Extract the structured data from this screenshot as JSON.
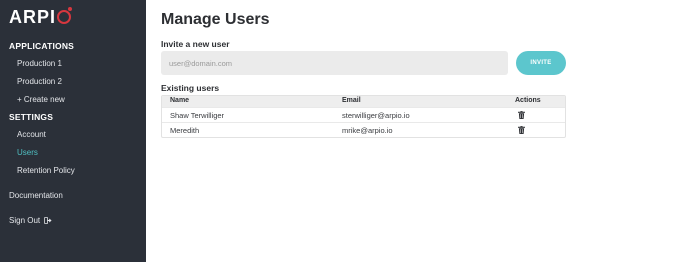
{
  "brand": {
    "name": "ARPI",
    "accent": "#d7373f"
  },
  "sidebar": {
    "applications_heading": "APPLICATIONS",
    "applications": [
      {
        "label": "Production 1"
      },
      {
        "label": "Production 2"
      },
      {
        "label": "+ Create new"
      }
    ],
    "settings_heading": "SETTINGS",
    "settings": [
      {
        "label": "Account"
      },
      {
        "label": "Users",
        "active": true
      },
      {
        "label": "Retention Policy"
      }
    ],
    "documentation_label": "Documentation",
    "signout_label": "Sign Out",
    "colors": {
      "background": "#2b3039",
      "active": "#4fbfc2"
    }
  },
  "main": {
    "title": "Manage Users",
    "invite_heading": "Invite a new user",
    "invite_placeholder": "user@domain.com",
    "invite_button": "INVITE",
    "existing_heading": "Existing users",
    "table": {
      "headers": {
        "name": "Name",
        "email": "Email",
        "actions": "Actions"
      },
      "rows": [
        {
          "name": "Shaw Terwilliger",
          "email": "sterwilliger@arpio.io",
          "action_icon": "trash-icon"
        },
        {
          "name": "Meredith",
          "email": "mrike@arpio.io",
          "action_icon": "trash-icon"
        }
      ]
    },
    "accent": "#5cc6cd"
  }
}
